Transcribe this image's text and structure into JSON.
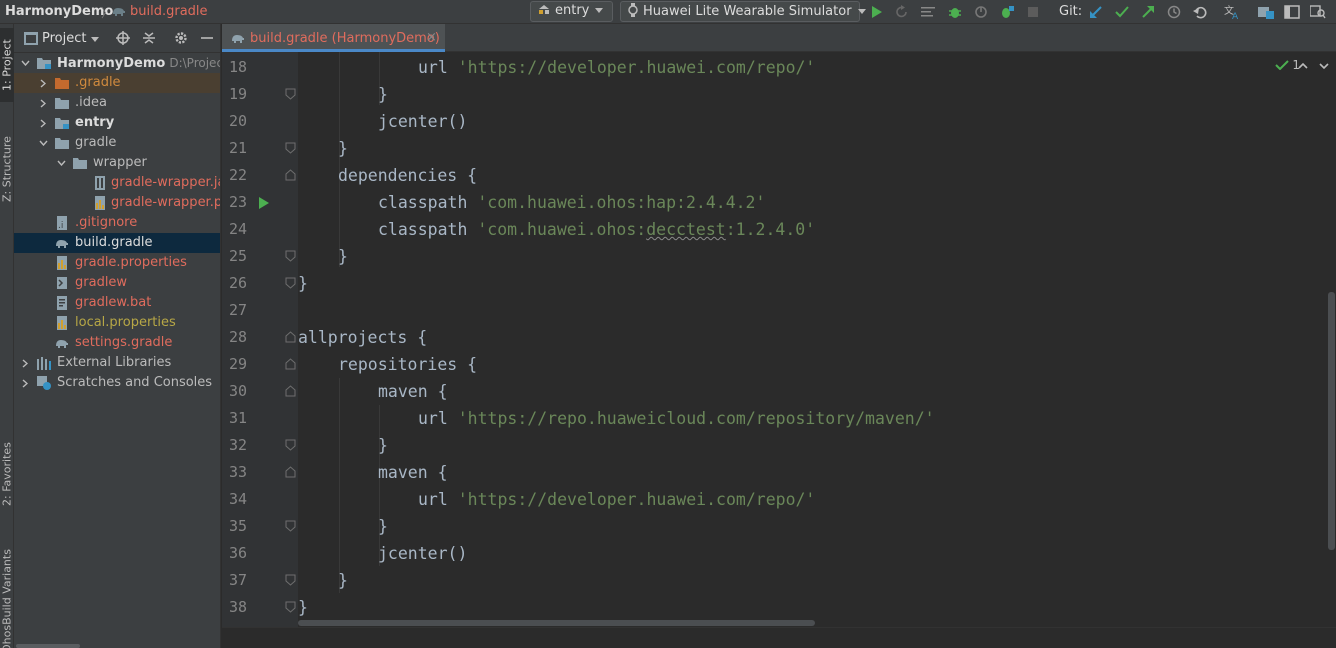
{
  "navbar": {
    "project": "HarmonyDemo",
    "separator": "〉",
    "file": "build.gradle",
    "run_config": "entry",
    "device": "Huawei Lite Wearable Simulator",
    "git_label": "Git:"
  },
  "left_strip": {
    "project_tab": "1: Project",
    "structure_tab": "Z: Structure",
    "favorites_tab": "2: Favorites",
    "ohos_tab": "OhosBuild Variants"
  },
  "project_panel": {
    "title": "Project",
    "root": {
      "name": "HarmonyDemo",
      "path": "D:\\Project_"
    },
    "items": [
      {
        "label": ".gradle",
        "icon": "folder-icon"
      },
      {
        "label": ".idea",
        "icon": "folder-icon"
      },
      {
        "label": "entry",
        "icon": "module-folder-icon"
      },
      {
        "label": "gradle",
        "icon": "folder-icon"
      },
      {
        "label": "wrapper",
        "icon": "folder-icon"
      },
      {
        "label": "gradle-wrapper.jar",
        "icon": "jar-file-icon"
      },
      {
        "label": "gradle-wrapper.properties",
        "icon": "properties-file-icon"
      },
      {
        "label": ".gitignore",
        "icon": "ignore-file-icon"
      },
      {
        "label": "build.gradle",
        "icon": "gradle-file-icon"
      },
      {
        "label": "gradle.properties",
        "icon": "properties-file-icon"
      },
      {
        "label": "gradlew",
        "icon": "script-file-icon"
      },
      {
        "label": "gradlew.bat",
        "icon": "bat-file-icon"
      },
      {
        "label": "local.properties",
        "icon": "properties-file-icon"
      },
      {
        "label": "settings.gradle",
        "icon": "gradle-file-icon"
      },
      {
        "label": "External Libraries",
        "icon": "libraries-icon"
      },
      {
        "label": "Scratches and Consoles",
        "icon": "scratches-icon"
      }
    ]
  },
  "editor": {
    "tab_label": "build.gradle (HarmonyDemo)",
    "tab_close": "×",
    "inspection_count": "1",
    "line_numbers": [
      "18",
      "19",
      "20",
      "21",
      "22",
      "23",
      "24",
      "25",
      "26",
      "27",
      "28",
      "29",
      "30",
      "31",
      "32",
      "33",
      "34",
      "35",
      "36",
      "37",
      "38"
    ],
    "code": {
      "l18_kw": "url ",
      "l18_str": "'https://developer.huawei.com/repo/'",
      "l19": "}",
      "l20": "jcenter()",
      "l21": "}",
      "l22": "dependencies {",
      "l23_kw": "classpath ",
      "l23_str": "'com.huawei.ohos:hap:2.4.4.2'",
      "l24_kw": "classpath ",
      "l24_str_a": "'com.huawei.ohos:",
      "l24_str_b": "decctest",
      "l24_str_c": ":1.2.4.0'",
      "l25": "}",
      "l26": "}",
      "l27": "",
      "l28": "allprojects {",
      "l29": "repositories {",
      "l30": "maven {",
      "l31_kw": "url ",
      "l31_str": "'https://repo.huaweicloud.com/repository/maven/'",
      "l32": "}",
      "l33": "maven {",
      "l34_kw": "url ",
      "l34_str": "'https://developer.huawei.com/repo/'",
      "l35": "}",
      "l36": "jcenter()",
      "l37": "}",
      "l38": "}"
    }
  },
  "colors": {
    "string": "#6a8759",
    "code": "#a9b7c6",
    "modified_file": "#e06c5d",
    "run_green": "#4caf50",
    "git_blue": "#3592c4"
  }
}
